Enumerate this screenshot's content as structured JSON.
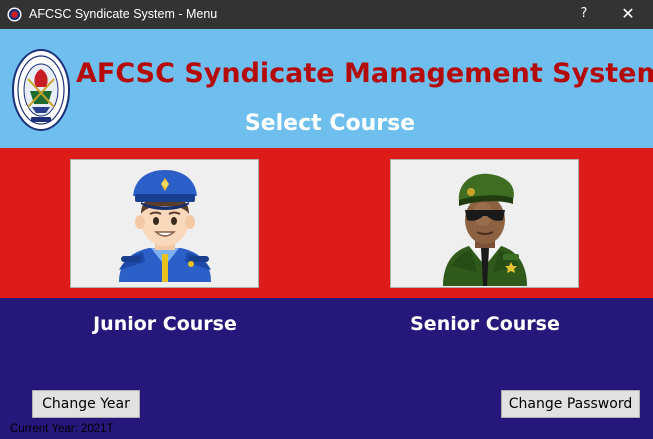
{
  "window": {
    "title": "AFCSC Syndicate System - Menu",
    "help_glyph": "?",
    "close_glyph": "✕"
  },
  "header": {
    "app_title": "AFCSC Syndicate Management System",
    "subtitle": "Select Course"
  },
  "courses": [
    {
      "label": "Junior Course",
      "icon": "police-officer-icon"
    },
    {
      "label": "Senior Course",
      "icon": "army-officer-icon"
    }
  ],
  "footer": {
    "change_year_label": "Change Year",
    "change_password_label": "Change Password",
    "current_year_text": "Current Year: 2021T"
  },
  "colors": {
    "titlebar": "#333333",
    "header_band": "#6fbfee",
    "title_red": "#b50a0a",
    "red_band": "#dd1c1a",
    "blue_band": "#26187a"
  }
}
